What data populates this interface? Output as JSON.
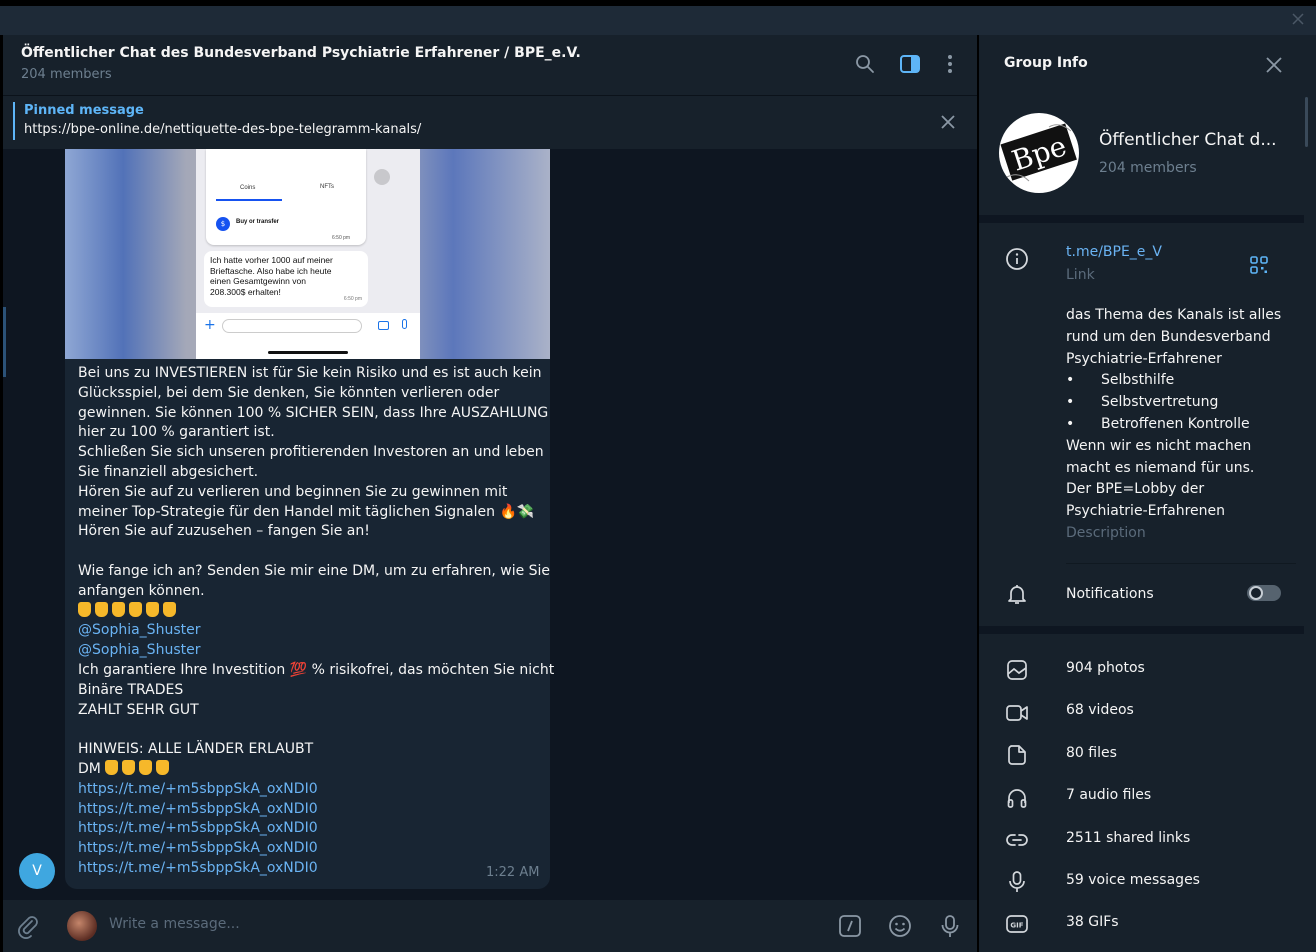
{
  "chat": {
    "title": "Öffentlicher Chat des Bundesverband Psychiatrie Erfahrener / BPE_e.V.",
    "members": "204 members"
  },
  "pinned": {
    "label": "Pinned message",
    "text": "https://bpe-online.de/nettiquette-des-bpe-telegramm-kanals/"
  },
  "message": {
    "photo": {
      "tab_coins": "Coins",
      "tab_nfts": "NFTs",
      "buy_label": "Buy or transfer",
      "time1": "6:50 pm",
      "bubble_text": [
        "Ich hatte vorher 1000 auf meiner",
        "Brieftasche. Also habe ich heute",
        "einen Gesamtgewinn von",
        "208.300$ erhalten!"
      ],
      "time2": "6:50 pm"
    },
    "lines": [
      "Bei uns zu INVESTIEREN ist für Sie kein Risiko und es ist auch kein",
      "Glücksspiel, bei dem Sie denken, Sie könnten verlieren oder",
      "gewinnen. Sie können 100 % SICHER SEIN, dass Ihre AUSZAHLUNG",
      "hier zu 100 % garantiert ist.",
      "Schließen Sie sich unseren profitierenden Investoren an und leben",
      "Sie finanziell abgesichert.",
      "Hören Sie auf zu verlieren und beginnen Sie zu gewinnen mit",
      "meiner Top-Strategie für den Handel mit täglichen Signalen",
      "Hören Sie auf zuzusehen – fangen Sie an!",
      "",
      "Wie fange ich an? Senden Sie mir eine DM, um zu erfahren, wie Sie",
      "anfangen können."
    ],
    "mention1": "@Sophia_Shuster",
    "mention2": "@Sophia_Shuster",
    "guarantee_pre": "Ich garantiere Ihre Investition",
    "guarantee_emoji": "💯",
    "guarantee_post": "% risikofrei, das möchten Sie nicht",
    "line_binary": "Binäre TRADES",
    "line_pays": "ZAHLT SEHR GUT",
    "line_notice": "HINWEIS: ALLE LÄNDER ERLAUBT",
    "line_dm": "DM",
    "links": [
      "https://t.me/+m5sbppSkA_oxNDI0",
      "https://t.me/+m5sbppSkA_oxNDI0",
      "https://t.me/+m5sbppSkA_oxNDI0",
      "https://t.me/+m5sbppSkA_oxNDI0",
      "https://t.me/+m5sbppSkA_oxNDI0"
    ],
    "time": "1:22 AM",
    "sender_initial": "V"
  },
  "input": {
    "placeholder": "Write a message..."
  },
  "panel": {
    "title": "Group Info",
    "group_name": "Öffentlicher Chat d...",
    "members": "204 members",
    "avatar_text": "Bpe",
    "link": "t.me/BPE_e_V",
    "link_label": "Link",
    "description": [
      "das Thema des Kanals ist alles",
      "rund um den Bundesverband",
      "Psychiatrie-Erfahrener"
    ],
    "bullets": [
      "Selbsthilfe",
      "Selbstvertretung",
      "Betroffenen Kontrolle"
    ],
    "bullet_char": "•",
    "description_tail": [
      "Wenn wir es nicht machen",
      "macht es niemand für uns.",
      "Der BPE=Lobby der",
      "Psychiatrie-Erfahrenen"
    ],
    "description_label": "Description",
    "notifications": "Notifications",
    "notifications_on": false,
    "media": [
      {
        "icon": "photo-icon",
        "label": "904 photos"
      },
      {
        "icon": "video-icon",
        "label": "68 videos"
      },
      {
        "icon": "file-icon",
        "label": "80 files"
      },
      {
        "icon": "headphones-icon",
        "label": "7 audio files"
      },
      {
        "icon": "link-icon",
        "label": "2511 shared links"
      },
      {
        "icon": "microphone-icon",
        "label": "59 voice messages"
      },
      {
        "icon": "gif-icon",
        "label": "38 GIFs"
      }
    ]
  },
  "colors": {
    "accent": "#5eb5f7",
    "link": "#6ab3f3",
    "chat_bg": "#0e1621",
    "panel_bg": "#17212b",
    "bubble_bg": "#182533"
  }
}
